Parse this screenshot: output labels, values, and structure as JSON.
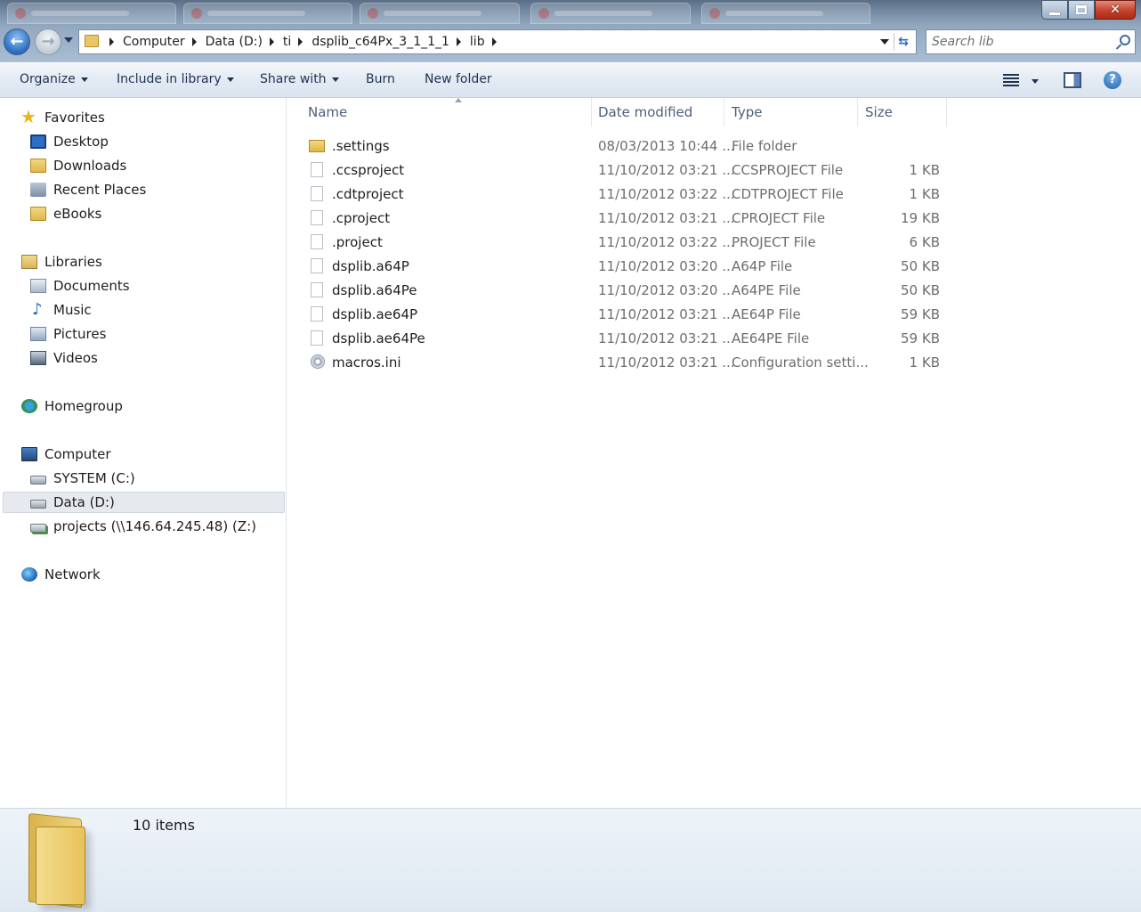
{
  "address": {
    "crumbs": [
      "Computer",
      "Data (D:)",
      "ti",
      "dsplib_c64Px_3_1_1_1",
      "lib"
    ]
  },
  "search": {
    "placeholder": "Search lib"
  },
  "toolbar": {
    "organize": "Organize",
    "include_in_library": "Include in library",
    "share_with": "Share with",
    "burn": "Burn",
    "new_folder": "New folder"
  },
  "nav": {
    "favorites": {
      "label": "Favorites",
      "items": [
        "Desktop",
        "Downloads",
        "Recent Places",
        "eBooks"
      ]
    },
    "libraries": {
      "label": "Libraries",
      "items": [
        "Documents",
        "Music",
        "Pictures",
        "Videos"
      ]
    },
    "homegroup": "Homegroup",
    "computer": {
      "label": "Computer",
      "items": [
        "SYSTEM (C:)",
        "Data (D:)",
        "projects (\\\\146.64.245.48) (Z:)"
      ]
    },
    "network": "Network"
  },
  "columns": {
    "name": "Name",
    "date": "Date modified",
    "type": "Type",
    "size": "Size"
  },
  "files": [
    {
      "name": ".settings",
      "date": "08/03/2013 10:44 ...",
      "type": "File folder",
      "size": "",
      "icon": "folder-icon"
    },
    {
      "name": ".ccsproject",
      "date": "11/10/2012 03:21 ...",
      "type": "CCSPROJECT File",
      "size": "1 KB",
      "icon": "file-icon"
    },
    {
      "name": ".cdtproject",
      "date": "11/10/2012 03:22 ...",
      "type": "CDTPROJECT File",
      "size": "1 KB",
      "icon": "file-icon"
    },
    {
      "name": ".cproject",
      "date": "11/10/2012 03:21 ...",
      "type": "CPROJECT File",
      "size": "19 KB",
      "icon": "file-icon"
    },
    {
      "name": ".project",
      "date": "11/10/2012 03:22 ...",
      "type": "PROJECT File",
      "size": "6 KB",
      "icon": "file-icon"
    },
    {
      "name": "dsplib.a64P",
      "date": "11/10/2012 03:20 ...",
      "type": "A64P File",
      "size": "50 KB",
      "icon": "file-icon"
    },
    {
      "name": "dsplib.a64Pe",
      "date": "11/10/2012 03:20 ...",
      "type": "A64PE File",
      "size": "50 KB",
      "icon": "file-icon"
    },
    {
      "name": "dsplib.ae64P",
      "date": "11/10/2012 03:21 ...",
      "type": "AE64P File",
      "size": "59 KB",
      "icon": "file-icon"
    },
    {
      "name": "dsplib.ae64Pe",
      "date": "11/10/2012 03:21 ...",
      "type": "AE64PE File",
      "size": "59 KB",
      "icon": "file-icon"
    },
    {
      "name": "macros.ini",
      "date": "11/10/2012 03:21 ...",
      "type": "Configuration setti...",
      "size": "1 KB",
      "icon": "config-file-icon"
    }
  ],
  "details": {
    "count": "10 items"
  },
  "colors": {
    "titlebar": "#7e95ad",
    "selection": "#e6eaef",
    "link_text": "#1e3351"
  }
}
